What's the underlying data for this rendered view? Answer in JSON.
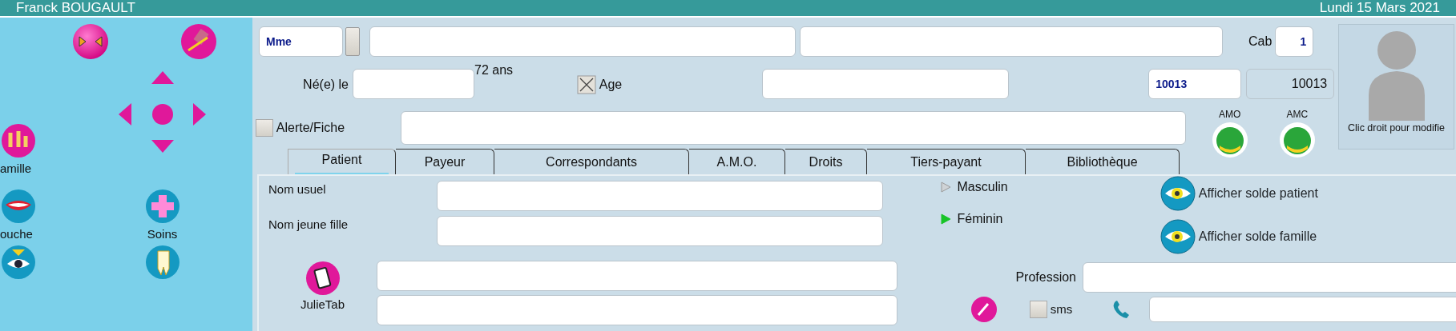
{
  "title_bar": {
    "user": "Franck BOUGAULT",
    "date": "Lundi 15 Mars 2021"
  },
  "sidebar": {
    "buttons": [
      {
        "label": "amille"
      },
      {
        "label": "ouche"
      },
      {
        "label": "Soins"
      }
    ]
  },
  "header": {
    "civility": "Mme",
    "cab_label": "Cab",
    "cab": "1",
    "birth_label": "Né(e) le",
    "age": "72 ans",
    "age_checkbox": {
      "label": "Age",
      "checked": true
    },
    "dossier_number": "10013",
    "dossier_number_2": "10013",
    "alert": {
      "label": "Alerte/Fiche",
      "checked": false
    },
    "coverage": [
      "AMO",
      "AMC"
    ],
    "photo_caption": "Clic droit pour modifie"
  },
  "tabs": [
    {
      "label": "Patient",
      "selected": true
    },
    {
      "label": "Payeur",
      "selected": false
    },
    {
      "label": "Correspondants",
      "selected": false
    },
    {
      "label": "A.M.O.",
      "selected": false
    },
    {
      "label": "Droits",
      "selected": false
    },
    {
      "label": "Tiers-payant",
      "selected": false
    },
    {
      "label": "Bibliothèque",
      "selected": false
    }
  ],
  "form": {
    "nom_usuel_label": "Nom usuel",
    "nom_jeune_fille_label": "Nom jeune fille",
    "gender": [
      {
        "label": "Masculin",
        "selected": false
      },
      {
        "label": "Féminin",
        "selected": true
      }
    ],
    "balance_buttons": [
      "Afficher solde patient",
      "Afficher solde famille"
    ],
    "julietab_label": "JulieTab",
    "profession_label": "Profession",
    "sms": {
      "label": "sms",
      "checked": false
    }
  }
}
